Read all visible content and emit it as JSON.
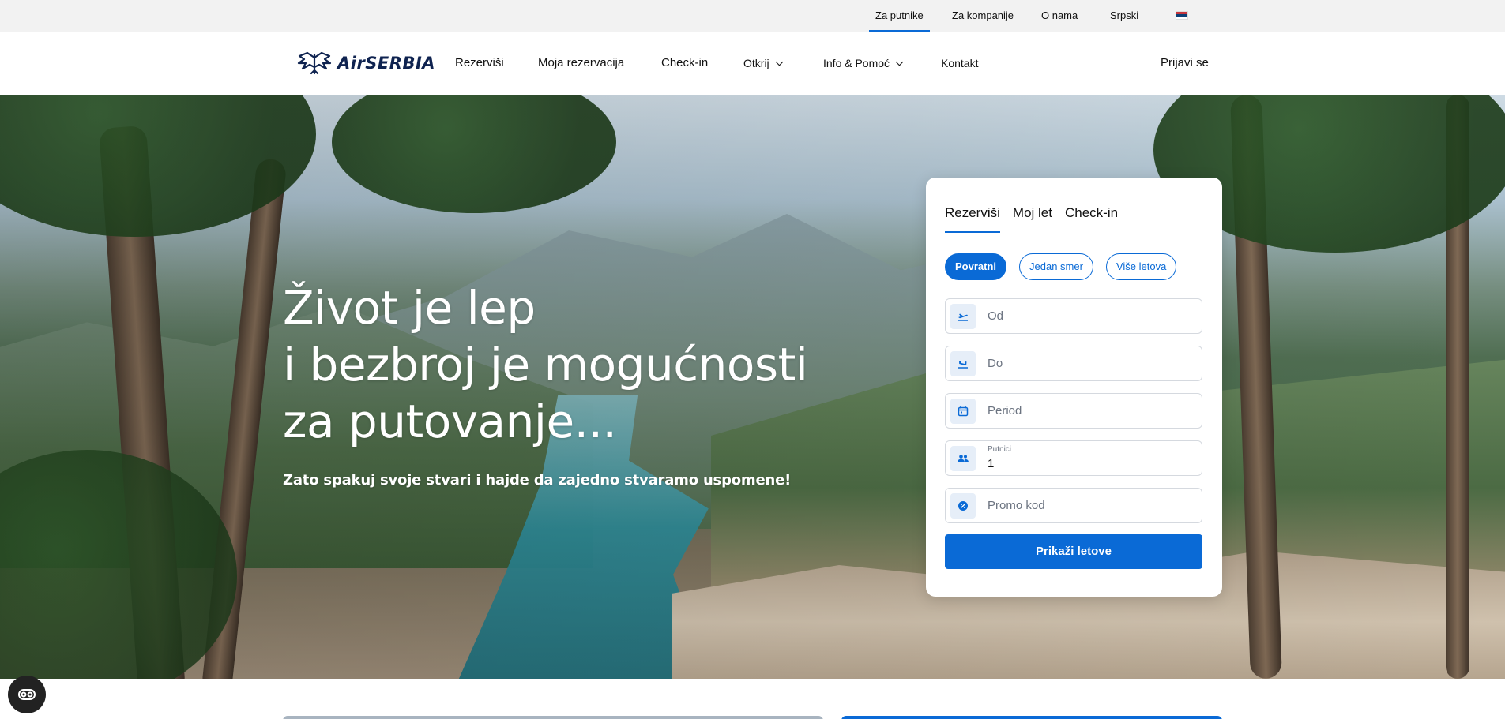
{
  "topbar": {
    "links": [
      "Za putnike",
      "Za kompanije",
      "O nama"
    ],
    "language": "Srpski"
  },
  "header": {
    "logo_text": "AirSERBIA",
    "nav": [
      "Rezerviši",
      "Moja rezervacija",
      "Check-in",
      "Otkrij",
      "Info & Pomoć",
      "Kontakt"
    ],
    "login": "Prijavi se"
  },
  "hero": {
    "title_lines": [
      "Život je lep",
      "i bezbroj je mogućnosti",
      "za putovanje..."
    ],
    "subtitle": "Zato spakuj svoje stvari i hajde da zajedno stvaramo uspomene!"
  },
  "booking": {
    "tabs": [
      "Rezerviši",
      "Moj let",
      "Check-in"
    ],
    "trip_types": [
      "Povratni",
      "Jedan smer",
      "Više letova"
    ],
    "fields": {
      "from_placeholder": "Od",
      "to_placeholder": "Do",
      "period_placeholder": "Period",
      "passengers_label": "Putnici",
      "passengers_value": "1",
      "promo_placeholder": "Promo kod"
    },
    "submit": "Prikaži letove"
  },
  "icons": {
    "from": "takeoff-icon",
    "to": "landing-icon",
    "period": "calendar-icon",
    "passengers": "people-icon",
    "promo": "promo-badge-icon",
    "accessibility": "accessibility-icon",
    "language_flag": "serbian-flag-icon"
  },
  "colors": {
    "accent": "#0a6ad6",
    "logo": "#0f2350",
    "topbar_bg": "#f2f2f2"
  }
}
